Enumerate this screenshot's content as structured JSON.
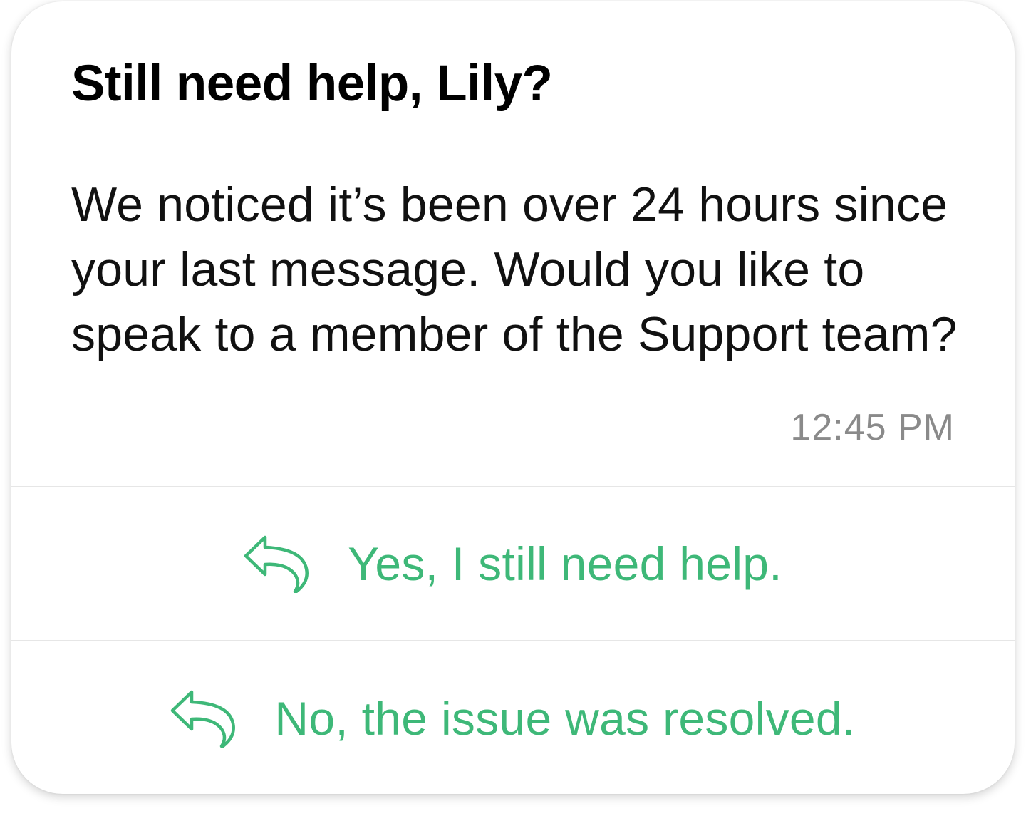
{
  "message": {
    "title": "Still need help, Lily?",
    "body": "We noticed it’s been over 24 hours since your last message. Would you like to speak to a member of the Support team?",
    "timestamp": "12:45 PM"
  },
  "options": [
    {
      "label": "Yes, I still need help.",
      "icon": "reply-arrow-icon"
    },
    {
      "label": "No, the issue was resolved.",
      "icon": "reply-arrow-icon"
    }
  ],
  "colors": {
    "accent": "#3eb878",
    "timestamp": "#8a8a8a",
    "divider": "#e6e6e6"
  }
}
